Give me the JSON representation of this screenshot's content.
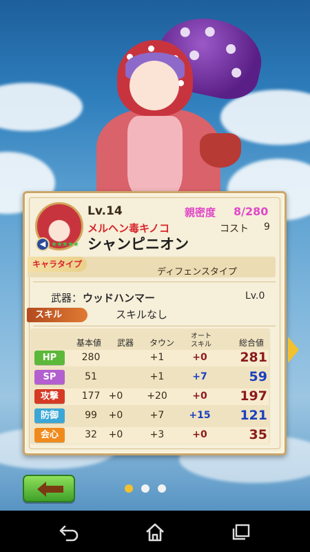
{
  "card": {
    "level": "Lv.14",
    "affection_label": "親密度",
    "affection_value": "8/280",
    "epithet": "メルヘン毒キノコ",
    "cost_label": "コスト",
    "cost_value": "9",
    "name": "シャンピニオン",
    "star_rating": 5
  },
  "chara_type": {
    "label": "キャラタイプ",
    "value": "ディフェンスタイプ"
  },
  "weapon": {
    "label": "武器：",
    "value": "ウッドハンマー",
    "level": "Lv.0"
  },
  "skill": {
    "label": "スキル",
    "value": "スキルなし"
  },
  "stats": {
    "headers": {
      "base": "基本値",
      "weapon": "武器",
      "town": "タウン",
      "auto_line1": "オート",
      "auto_line2": "スキル",
      "total": "総合値"
    },
    "rows": [
      {
        "label": "HP",
        "base": "280",
        "weapon": "",
        "town": "+1",
        "auto": "+0",
        "total": "281"
      },
      {
        "label": "SP",
        "base": "51",
        "weapon": "",
        "town": "+1",
        "auto": "+7",
        "total": "59"
      },
      {
        "label": "攻撃",
        "base": "177",
        "weapon": "+0",
        "town": "+20",
        "auto": "+0",
        "total": "197"
      },
      {
        "label": "防御",
        "base": "99",
        "weapon": "+0",
        "town": "+7",
        "auto": "+15",
        "total": "121"
      },
      {
        "label": "会心",
        "base": "32",
        "weapon": "+0",
        "town": "+3",
        "auto": "+0",
        "total": "35"
      }
    ]
  },
  "pagination": {
    "pages": 3,
    "current": 1
  },
  "colors": {
    "hp_badge": "#5cb83a",
    "sp_badge": "#b35fd0",
    "atk_badge": "#d63a25",
    "def_badge": "#3aa7d6",
    "crit_badge": "#f08a1c",
    "total_red": "#8a1a1a",
    "total_blue": "#1a3fc0",
    "auto_blue": "#1a3fc0",
    "auto_red": "#8a1a1a",
    "accent_pink": "#e048c8",
    "dot_active": "#f2c12e",
    "dot_inactive": "#f2f2f2"
  },
  "icons": {
    "back": "left-arrow-icon",
    "next": "right-triangle-icon",
    "nav_back": "android-back-icon",
    "nav_home": "android-home-icon",
    "nav_recent": "android-recent-apps-icon"
  }
}
